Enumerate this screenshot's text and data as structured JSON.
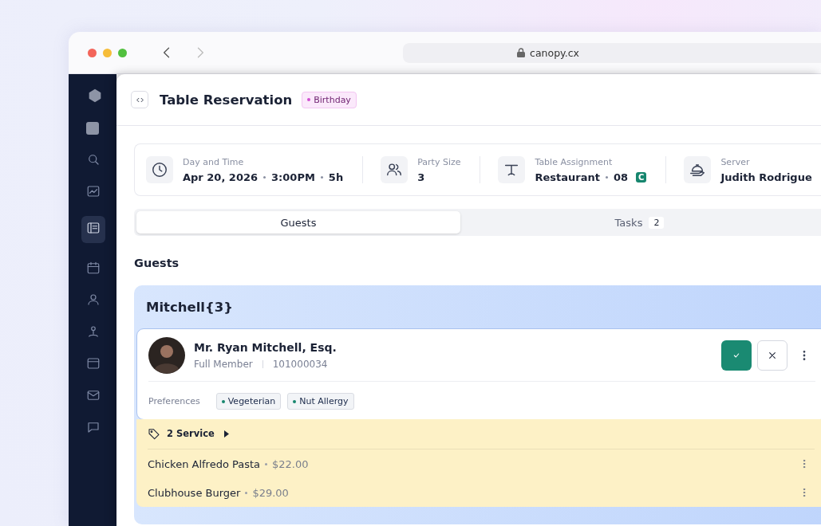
{
  "browser": {
    "address": "canopy.cx"
  },
  "header": {
    "title": "Table Reservation",
    "tag": "Birthday"
  },
  "details": [
    {
      "kind": "time",
      "label": "Day and Time",
      "parts": [
        "Apr 20, 2026",
        "3:00PM",
        "5h"
      ]
    },
    {
      "kind": "party",
      "label": "Party Size",
      "parts": [
        "3"
      ]
    },
    {
      "kind": "table",
      "label": "Table Assignment",
      "parts": [
        "Restaurant",
        "08"
      ],
      "badge": "C"
    },
    {
      "kind": "server",
      "label": "Server",
      "parts": [
        "Judith Rodrigue"
      ]
    }
  ],
  "tabs": [
    {
      "label": "Guests",
      "selected": true
    },
    {
      "label": "Tasks",
      "count": "2",
      "selected": false
    }
  ],
  "section_title": "Guests",
  "group": {
    "title": "Mitchell{3}",
    "guest": {
      "name": "Mr. Ryan Mitchell, Esq.",
      "membership": "Full Member",
      "number": "101000034",
      "preferences_label": "Preferences",
      "preferences": [
        "Vegeterian",
        "Nut Allergy"
      ]
    },
    "service": {
      "label": "2 Service",
      "items": [
        {
          "name": "Chicken Alfredo Pasta",
          "price": "$22.00"
        },
        {
          "name": "Clubhouse Burger",
          "price": "$29.00"
        }
      ]
    }
  }
}
